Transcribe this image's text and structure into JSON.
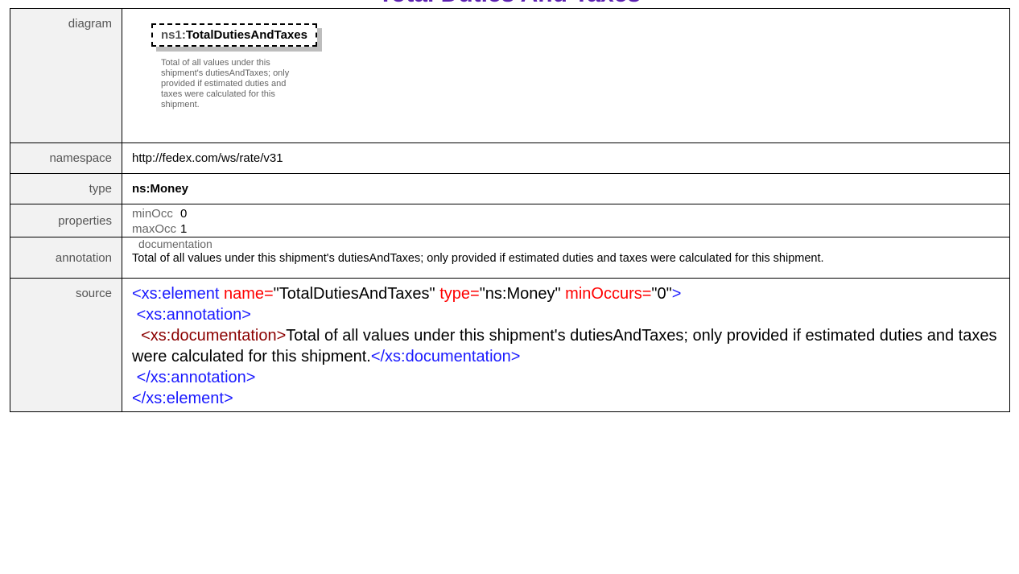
{
  "header": {
    "title": "Total Duties And Taxes"
  },
  "rows": {
    "diagram": {
      "label": "diagram",
      "element_prefix": "ns1:",
      "element_name": "TotalDutiesAndTaxes",
      "doc": "Total of all values under this shipment's dutiesAndTaxes; only provided if estimated duties and taxes were calculated for this shipment."
    },
    "namespace": {
      "label": "namespace",
      "value": "http://fedex.com/ws/rate/v31"
    },
    "type": {
      "label": "type",
      "value": "ns:Money"
    },
    "properties": {
      "label": "properties",
      "min_key": "minOcc",
      "min_val": "0",
      "max_key": "maxOcc",
      "max_val": "1"
    },
    "annotation": {
      "label": "annotation",
      "head": "documentation",
      "text": "Total of all values under this shipment's dutiesAndTaxes; only provided if estimated duties and taxes were calculated for this shipment."
    },
    "source": {
      "label": "source",
      "l1_tag": "<xs:element ",
      "l1_a1": "name=",
      "l1_v1": "\"TotalDutiesAndTaxes\" ",
      "l1_a2": "type=",
      "l1_v2": "\"ns:Money\" ",
      "l1_a3": "minOccurs=",
      "l1_v3": "\"0\"",
      "l1_end": ">",
      "l2": " <xs:annotation>",
      "l3_open": "  <xs:documentation>",
      "l3_text": "Total of all values under this shipment's dutiesAndTaxes; only provided if estimated duties and taxes were calculated for this shipment.",
      "l3_close": "</xs:documentation>",
      "l4": " </xs:annotation>",
      "l5": "</xs:element>"
    }
  },
  "colors": {
    "tag": "#1a1aff",
    "attr": "#ff0000",
    "doc_tag": "#8b0000",
    "title": "#5a1fb0"
  }
}
